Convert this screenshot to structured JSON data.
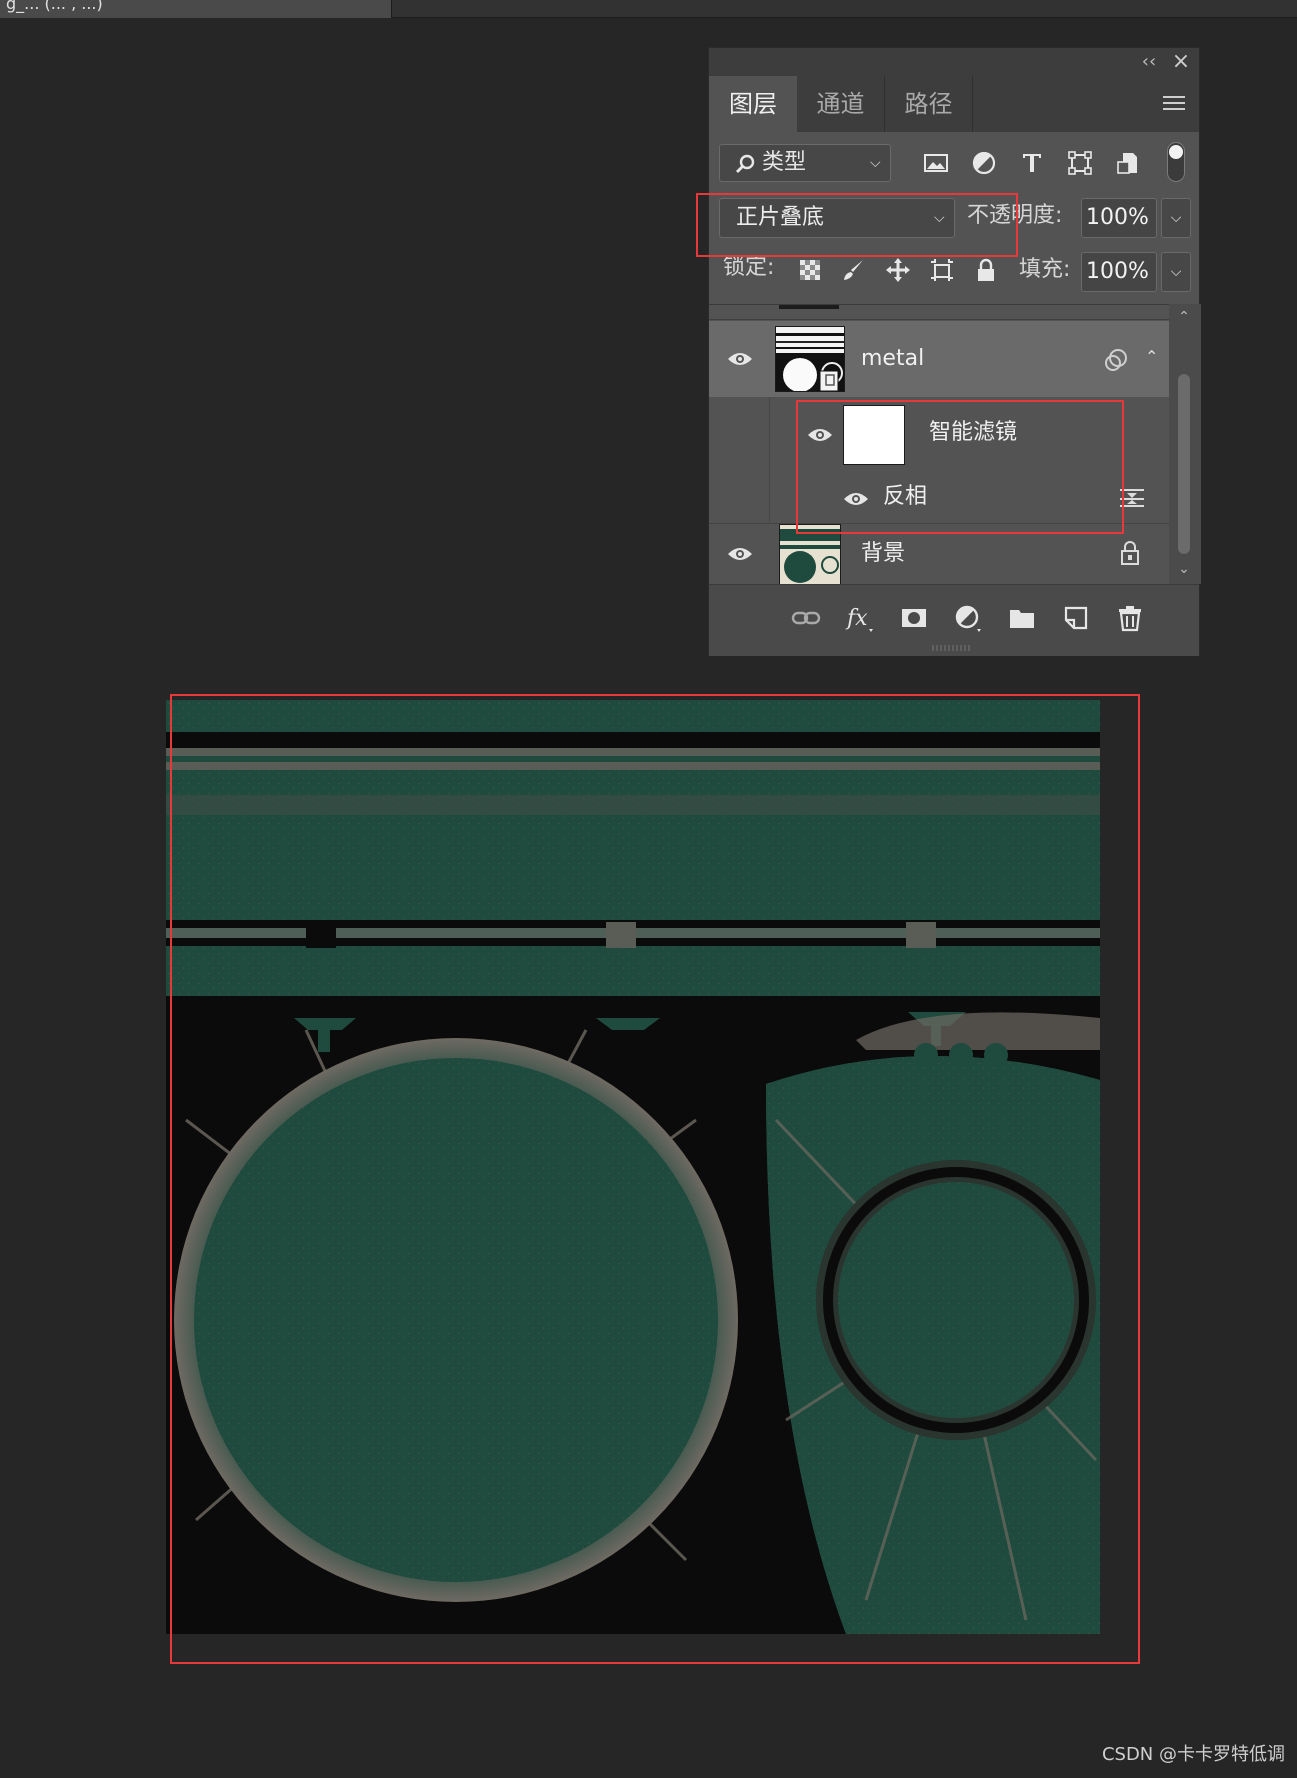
{
  "document_tab": {
    "title": "g_... (... , ...)"
  },
  "panel": {
    "tabs": [
      {
        "label": "图层",
        "active": true
      },
      {
        "label": "通道",
        "active": false
      },
      {
        "label": "路径",
        "active": false
      }
    ],
    "filter": {
      "label": "类型",
      "icons": [
        "image-filter-icon",
        "adjustment-filter-icon",
        "type-filter-icon",
        "shape-filter-icon",
        "smart-object-filter-icon"
      ]
    },
    "blend_mode": "正片叠底",
    "opacity_label": "不透明度:",
    "opacity_value": "100%",
    "lock_label": "锁定:",
    "fill_label": "填充:",
    "fill_value": "100%",
    "layers": [
      {
        "name": "metal",
        "visible": true,
        "type": "smart-object",
        "selected": true
      },
      {
        "name": "智能滤镜",
        "visible": true,
        "type": "smart-filter-mask"
      },
      {
        "name": "反相",
        "visible": true,
        "type": "filter"
      },
      {
        "name": "背景",
        "visible": true,
        "type": "background",
        "locked": true
      }
    ],
    "footer_icons": [
      "link-icon",
      "fx-icon",
      "mask-icon",
      "adjustment-icon",
      "folder-icon",
      "new-layer-icon",
      "trash-icon"
    ]
  },
  "colors": {
    "annotation": "#e63a3a",
    "canvas_green": "#1f4a3e",
    "canvas_gray": "#6f6a62"
  },
  "watermark": "CSDN @卡卡罗特低调"
}
